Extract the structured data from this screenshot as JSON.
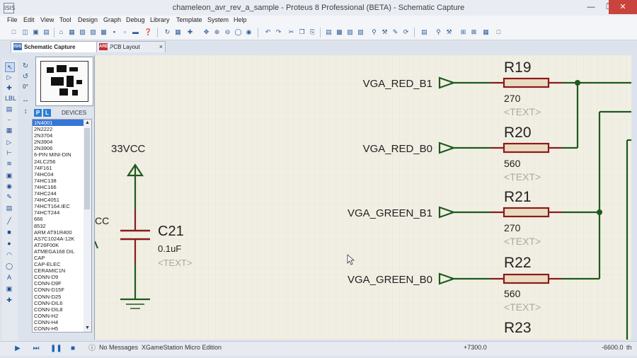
{
  "window": {
    "title": "chameleon_avr_rev_a_sample - Proteus 8 Professional (BETA) - Schematic Capture",
    "app_icon": "ISIS"
  },
  "menu": [
    "File",
    "Edit",
    "View",
    "Tool",
    "Design",
    "Graph",
    "Debug",
    "Library",
    "Template",
    "System",
    "Help"
  ],
  "tabs": [
    {
      "label": "Schematic Capture",
      "icon": "ISIS",
      "active": true
    },
    {
      "label": "PCB Layout",
      "icon": "ARES",
      "active": false
    }
  ],
  "rotation": {
    "angle_label": "0°"
  },
  "devices": {
    "header": "DEVICES",
    "pick_label": "P",
    "lib_label": "L",
    "items": [
      "1N4001",
      "2N2222",
      "2N3704",
      "2N3904",
      "2N3906",
      "6-PIN MINI-DIN",
      "24LC256",
      "74F161",
      "74HC04",
      "74HC138",
      "74HC166",
      "74HC244",
      "74HC4051",
      "74HCT164.IEC",
      "74HCT244",
      "666",
      "8532",
      "ARM AT91R400",
      "AS7C1024A-12K",
      "AT26F00K",
      "ATMEGA168 DIL",
      "CAP",
      "CAP-ELEC",
      "CERAMIC1N",
      "CONN-D9",
      "CONN-D9F",
      "CONN-D15F",
      "CONN-D25",
      "CONN-DIL6",
      "CONN-DIL8",
      "CONN-H2",
      "CONN-H4",
      "CONN-H5"
    ],
    "selected_index": 0
  },
  "schematic": {
    "power_label": "33VCC",
    "partial_label": "CC",
    "capacitor": {
      "ref": "C21",
      "value": "0.1uF",
      "text": "<TEXT>"
    },
    "nets": [
      "VGA_RED_B1",
      "VGA_RED_B0",
      "VGA_GREEN_B1",
      "VGA_GREEN_B0"
    ],
    "resistors": [
      {
        "ref": "R19",
        "value": "270",
        "text": "<TEXT>"
      },
      {
        "ref": "R20",
        "value": "560",
        "text": "<TEXT>"
      },
      {
        "ref": "R21",
        "value": "270",
        "text": "<TEXT>"
      },
      {
        "ref": "R22",
        "value": "560",
        "text": "<TEXT>"
      },
      {
        "ref": "R23",
        "value": "",
        "text": ""
      }
    ]
  },
  "status": {
    "messages": "No Messages",
    "sheet": "XGameStation Micro Edition",
    "x_coord": "+7300.0",
    "y_coord": "-6600.0",
    "units": "th"
  },
  "colors": {
    "wire": "#1d5a1d",
    "component": "#8b1a1a",
    "resistor_fill": "#e9dcc0",
    "canvas": "#f1efe3"
  }
}
